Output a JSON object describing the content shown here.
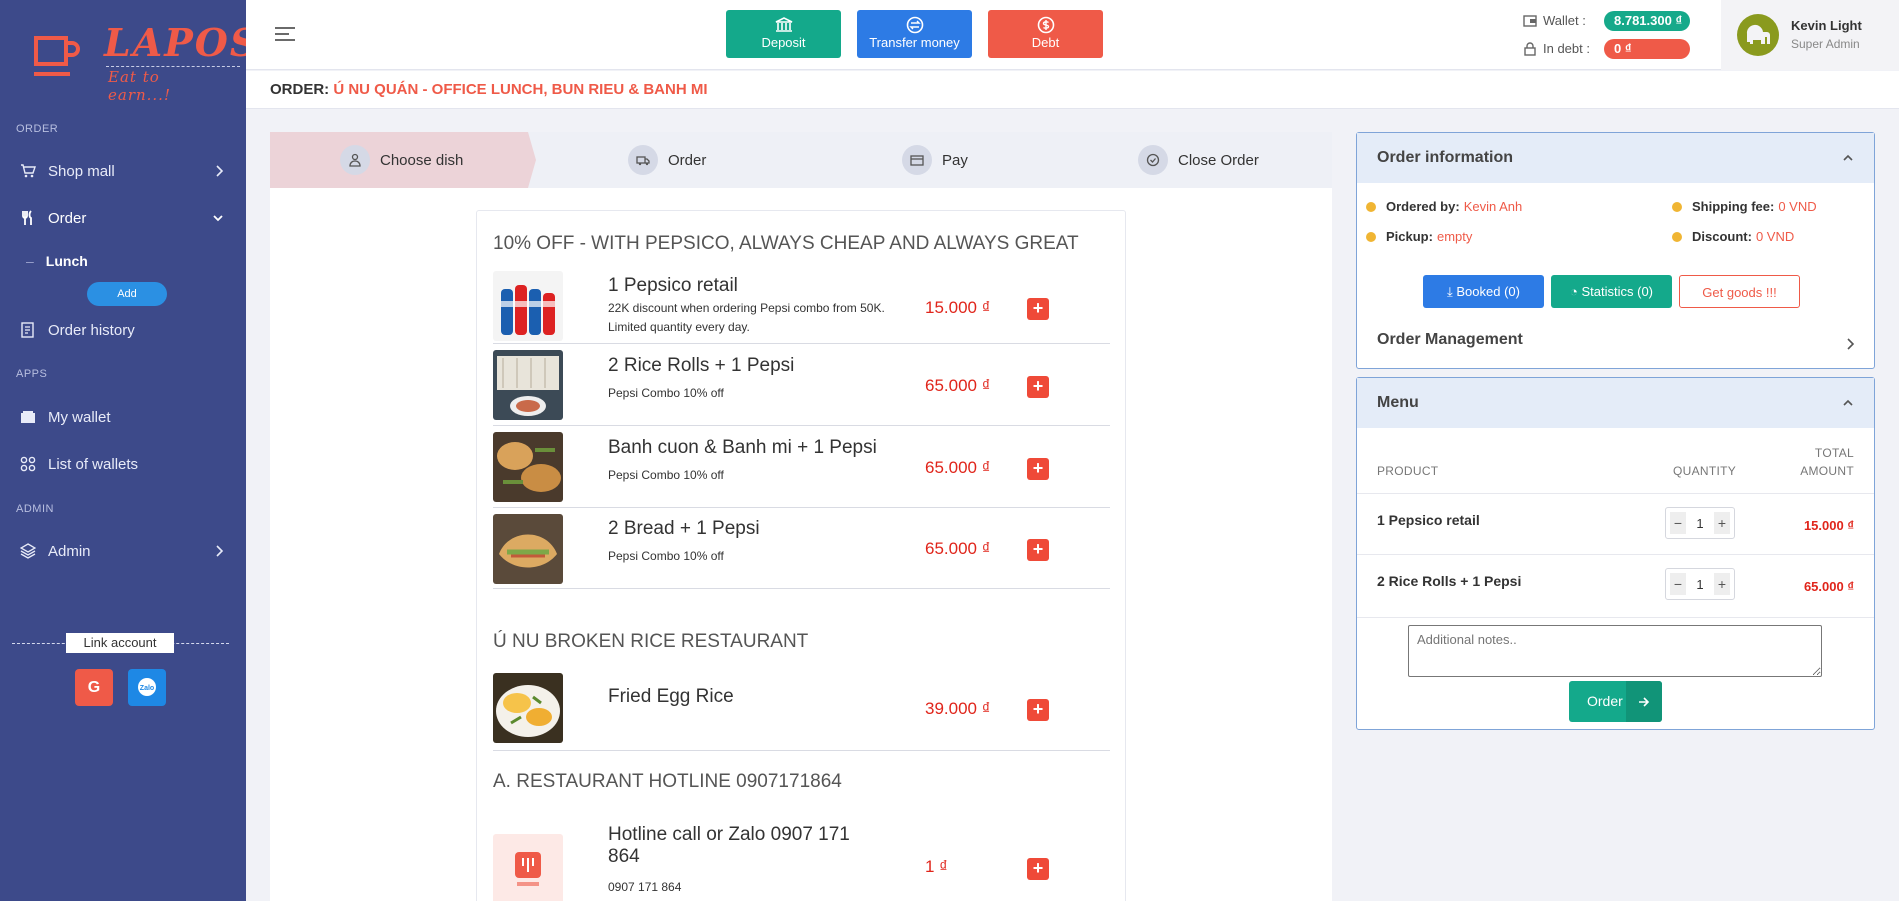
{
  "sidebar": {
    "logo_text": "LAPOS",
    "logo_slogan": "Eat to earn...!",
    "sections": {
      "order": "ORDER",
      "apps": "APPS",
      "admin": "ADMIN"
    },
    "items": {
      "shop_mall": "Shop mall",
      "order": "Order",
      "lunch": "Lunch",
      "add": "Add",
      "order_history": "Order history",
      "my_wallet": "My wallet",
      "list_of_wallets": "List of wallets",
      "admin": "Admin"
    },
    "link_account": "Link account",
    "social": {
      "google": "G",
      "zalo": "Zalo"
    }
  },
  "header": {
    "deposit": "Deposit",
    "transfer": "Transfer money",
    "debt": "Debt",
    "wallet_label": "Wallet :",
    "wallet_value": "8.781.300 ₫",
    "debt_label": "In debt :",
    "debt_value": "0 ₫",
    "user_name": "Kevin Light",
    "user_role": "Super Admin"
  },
  "order_bar": {
    "label": "ORDER:",
    "value": "Ú NU QUÁN - OFFICE LUNCH, BUN RIEU & BANH MI"
  },
  "steps": [
    "Choose dish",
    "Order",
    "Pay",
    "Close Order"
  ],
  "menu": {
    "sections": [
      {
        "title": "10% OFF - WITH PEPSICO, ALWAYS CHEAP AND ALWAYS GREAT",
        "dishes": [
          {
            "name": "1 Pepsico retail",
            "desc": "22K discount when ordering Pepsi combo from 50K. Limited quantity every day.",
            "price": "15.000 ₫"
          },
          {
            "name": "2 Rice Rolls + 1 Pepsi",
            "desc": "Pepsi Combo 10% off",
            "price": "65.000 ₫"
          },
          {
            "name": "Banh cuon & Banh mi + 1 Pepsi",
            "desc": "Pepsi Combo 10% off",
            "price": "65.000 ₫"
          },
          {
            "name": "2 Bread + 1 Pepsi",
            "desc": "Pepsi Combo 10% off",
            "price": "65.000 ₫"
          }
        ]
      },
      {
        "title": "Ú NU BROKEN RICE RESTAURANT",
        "dishes": [
          {
            "name": "Fried Egg Rice",
            "desc": "",
            "price": "39.000 ₫"
          }
        ]
      },
      {
        "title": "A. RESTAURANT HOTLINE 0907171864",
        "dishes": [
          {
            "name": "Hotline call or Zalo 0907 171 864",
            "desc": "0907 171 864",
            "price": "1 ₫"
          }
        ]
      }
    ]
  },
  "order_info": {
    "title": "Order information",
    "ordered_by_label": "Ordered by:",
    "ordered_by": "Kevin Anh",
    "shipping_label": "Shipping fee:",
    "shipping": "0 VND",
    "pickup_label": "Pickup:",
    "pickup": "empty",
    "discount_label": "Discount:",
    "discount": "0 VND",
    "booked": "Booked (0)",
    "statistics": "Statistics (0)",
    "get_goods": "Get goods !!!",
    "management": "Order Management"
  },
  "cart": {
    "title": "Menu",
    "col_product": "PRODUCT",
    "col_quantity": "QUANTITY",
    "col_total_1": "TOTAL",
    "col_total_2": "AMOUNT",
    "rows": [
      {
        "name": "1 Pepsico retail",
        "qty": "1",
        "total": "15.000 ₫"
      },
      {
        "name": "2 Rice Rolls + 1 Pepsi",
        "qty": "1",
        "total": "65.000 ₫"
      }
    ],
    "notes_placeholder": "Additional notes..",
    "order_button": "Order"
  },
  "colors": {
    "sidebar": "#3d4a8a",
    "accent_red": "#ef5a48",
    "accent_green": "#14a98b",
    "accent_blue": "#2d7be5"
  }
}
